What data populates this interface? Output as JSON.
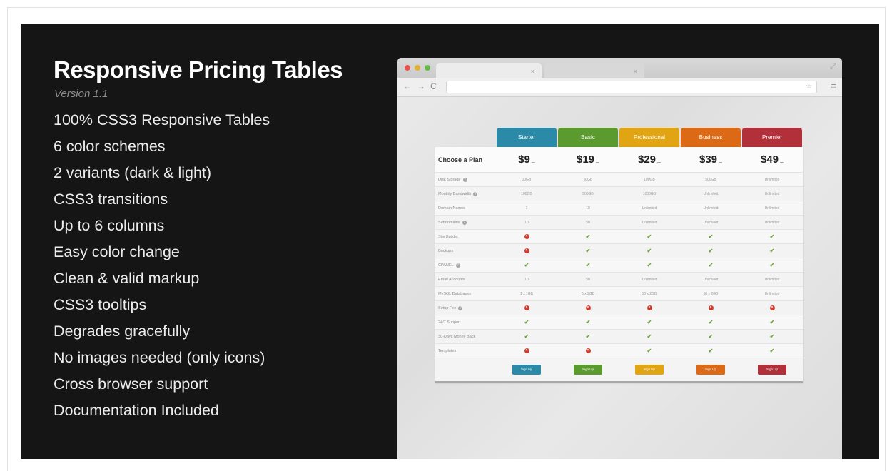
{
  "banner": {
    "title": "Responsive Pricing Tables",
    "version": "Version 1.1",
    "features": [
      "100% CSS3 Responsive Tables",
      "6 color schemes",
      "2 variants (dark & light)",
      "CSS3 transitions",
      "Up to 6 columns",
      "Easy color change",
      "Clean & valid markup",
      "CSS3 tooltips",
      "Degrades gracefully",
      "No images needed (only icons)",
      "Cross browser support",
      "Documentation Included"
    ]
  },
  "browser": {
    "nav_icons": [
      "back-arrow-icon",
      "forward-arrow-icon",
      "reload-icon"
    ],
    "icons": {
      "back": "←",
      "forward": "→",
      "reload": "C",
      "star": "☆",
      "menu": "≡",
      "resize": "⤢",
      "close": "×"
    }
  },
  "pricing": {
    "choose_label": "Choose a Plan",
    "plans": [
      {
        "name": "Starter",
        "price": "$9",
        "unit": "—",
        "color": "#2a8aa7",
        "button": "Sign Up"
      },
      {
        "name": "Basic",
        "price": "$19",
        "unit": "—",
        "color": "#5a9a2e",
        "button": "Sign Up"
      },
      {
        "name": "Professional",
        "price": "$29",
        "unit": "—",
        "color": "#e1a413",
        "button": "Sign Up"
      },
      {
        "name": "Business",
        "price": "$39",
        "unit": "—",
        "color": "#dc6915",
        "button": "Sign Up"
      },
      {
        "name": "Premier",
        "price": "$49",
        "unit": "—",
        "color": "#b1303a",
        "button": "Sign Up"
      }
    ],
    "features": [
      {
        "label": "Disk Storage",
        "info": true,
        "values": [
          "10GB",
          "50GB",
          "100GB",
          "500GB",
          "Unlimited"
        ]
      },
      {
        "label": "Monthly Bandwidth",
        "info": true,
        "values": [
          "100GB",
          "500GB",
          "1000GB",
          "Unlimited",
          "Unlimited"
        ]
      },
      {
        "label": "Domain Names",
        "info": false,
        "values": [
          "1",
          "10",
          "Unlimited",
          "Unlimited",
          "Unlimited"
        ]
      },
      {
        "label": "Subdomains",
        "info": true,
        "values": [
          "10",
          "50",
          "Unlimited",
          "Unlimited",
          "Unlimited"
        ]
      },
      {
        "label": "Site Builder",
        "info": false,
        "values": [
          "no",
          "yes",
          "yes",
          "yes",
          "yes"
        ]
      },
      {
        "label": "Backups",
        "info": false,
        "values": [
          "no",
          "yes",
          "yes",
          "yes",
          "yes"
        ]
      },
      {
        "label": "CPANEL",
        "info": true,
        "values": [
          "yes",
          "yes",
          "yes",
          "yes",
          "yes"
        ]
      },
      {
        "label": "Email Accounts",
        "info": false,
        "values": [
          "10",
          "50",
          "Unlimited",
          "Unlimited",
          "Unlimited"
        ]
      },
      {
        "label": "MySQL Databases",
        "info": false,
        "values": [
          "1 x 1GB",
          "5 x 2GB",
          "10 x 2GB",
          "50 x 2GB",
          "Unlimited"
        ]
      },
      {
        "label": "Setup Fee",
        "info": true,
        "values": [
          "no",
          "no",
          "no",
          "no",
          "no"
        ]
      },
      {
        "label": "24/7 Support",
        "info": false,
        "values": [
          "yes",
          "yes",
          "yes",
          "yes",
          "yes"
        ]
      },
      {
        "label": "30-Days Money Back",
        "info": false,
        "values": [
          "yes",
          "yes",
          "yes",
          "yes",
          "yes"
        ]
      },
      {
        "label": "Templates",
        "info": false,
        "values": [
          "no",
          "no",
          "yes",
          "yes",
          "yes"
        ]
      }
    ],
    "yes_glyph": "✔",
    "no_glyph": "×",
    "info_glyph": "?"
  }
}
